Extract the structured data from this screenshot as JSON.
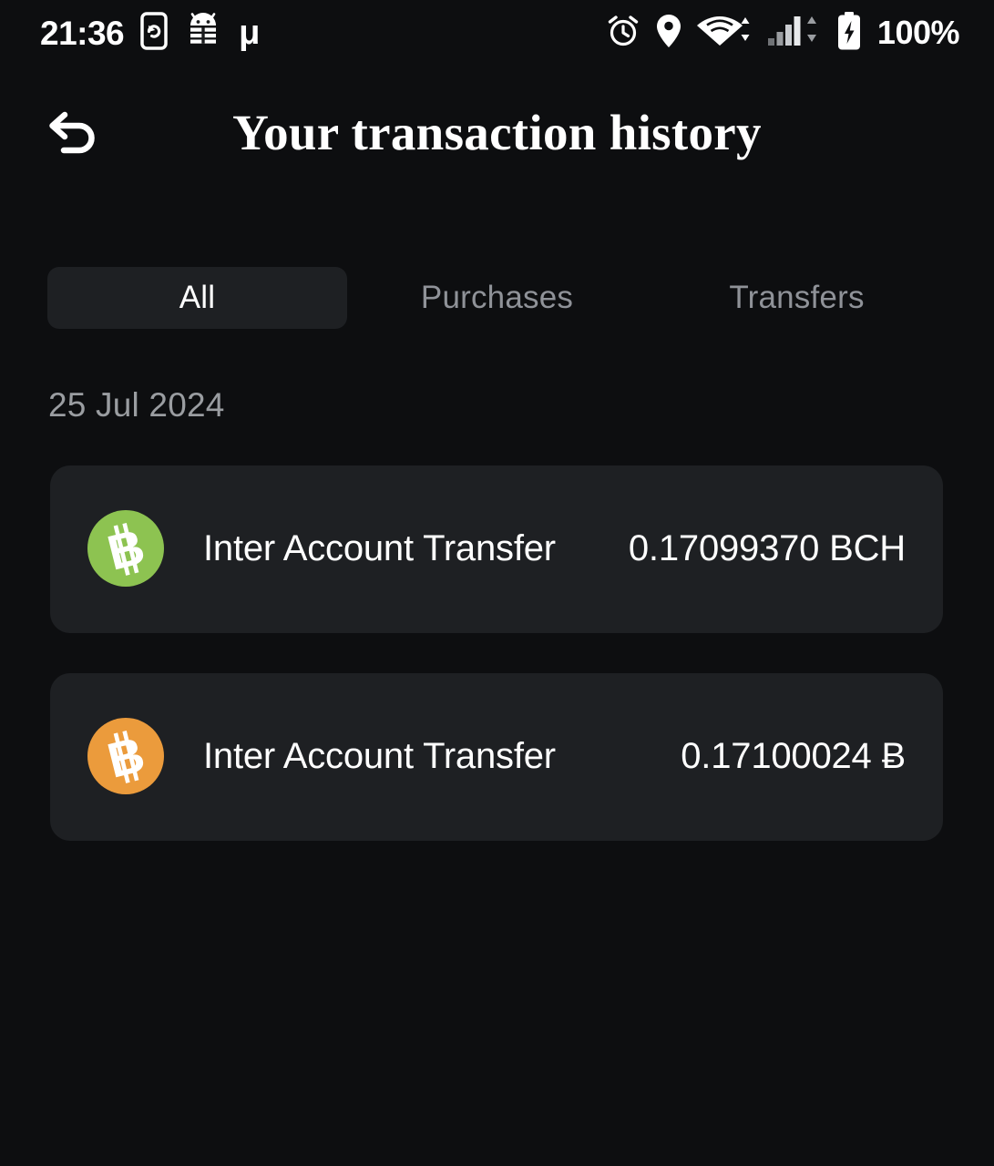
{
  "status_bar": {
    "time": "21:36",
    "battery_percent": "100%",
    "left_icons": [
      "phone-rotate-icon",
      "android-robot-icon",
      "mu-character-icon"
    ],
    "right_icons": [
      "alarm-clock-icon",
      "location-pin-icon",
      "wifi-icon",
      "cellular-signal-icon",
      "battery-charging-icon"
    ],
    "mu_glyph": "μ"
  },
  "header": {
    "back_label": "back-arrow",
    "title": "Your transaction history"
  },
  "tabs": [
    {
      "label": "All",
      "active": true
    },
    {
      "label": "Purchases",
      "active": false
    },
    {
      "label": "Transfers",
      "active": false
    }
  ],
  "groups": [
    {
      "date": "25 Jul 2024",
      "transactions": [
        {
          "title": "Inter Account Transfer",
          "amount": "0.17099370 BCH",
          "coin_symbol": "Ƀ",
          "coin_name": "bitcoin-cash-icon",
          "coin_color": "#8dc351"
        },
        {
          "title": "Inter Account Transfer",
          "amount": "0.17100024 Ƀ",
          "coin_symbol": "Ƀ",
          "coin_name": "bitcoin-icon",
          "coin_color": "#eb9b3c"
        }
      ]
    }
  ],
  "colors": {
    "page_background": "#0d0e10",
    "card_background": "#1e2023",
    "active_tab_background": "#1e2023",
    "primary_text": "#ffffff",
    "muted_text": "#8f9298",
    "bitcoin_orange": "#eb9b3c",
    "bitcoin_cash_green": "#8dc351"
  }
}
